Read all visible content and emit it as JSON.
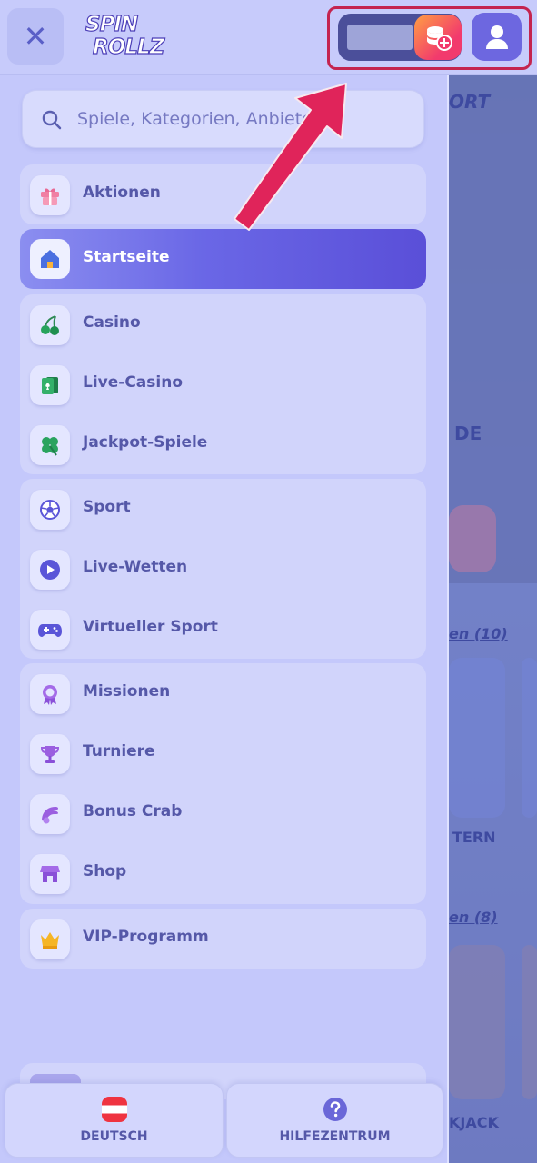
{
  "header": {
    "close_label": "✕",
    "logo_line1": "SPIN",
    "logo_line2": "ROLLZ"
  },
  "search": {
    "placeholder": "Spiele, Kategorien, Anbieter"
  },
  "menu": {
    "promo": {
      "label": "Aktionen"
    },
    "home": {
      "label": "Startseite"
    },
    "games": [
      {
        "label": "Casino"
      },
      {
        "label": "Live-Casino"
      },
      {
        "label": "Jackpot-Spiele"
      }
    ],
    "sport": [
      {
        "label": "Sport"
      },
      {
        "label": "Live-Wetten"
      },
      {
        "label": "Virtueller Sport"
      }
    ],
    "extras": [
      {
        "label": "Missionen"
      },
      {
        "label": "Turniere"
      },
      {
        "label": "Bonus Crab"
      },
      {
        "label": "Shop"
      }
    ],
    "vip": {
      "label": "VIP-Programm"
    }
  },
  "bottom": {
    "language": "DEUTSCH",
    "help": "HILFEZENTRUM"
  },
  "background": {
    "sport_text": "ORT",
    "de_text": "DE",
    "row1_link": "en (10)",
    "row1_caption": "TERN",
    "row2_link": "en (8)",
    "row2_caption": "KJACK"
  },
  "colors": {
    "accent": "#5a4fd8",
    "highlight_border": "#c4244f",
    "panel": "#c4c8fb"
  }
}
